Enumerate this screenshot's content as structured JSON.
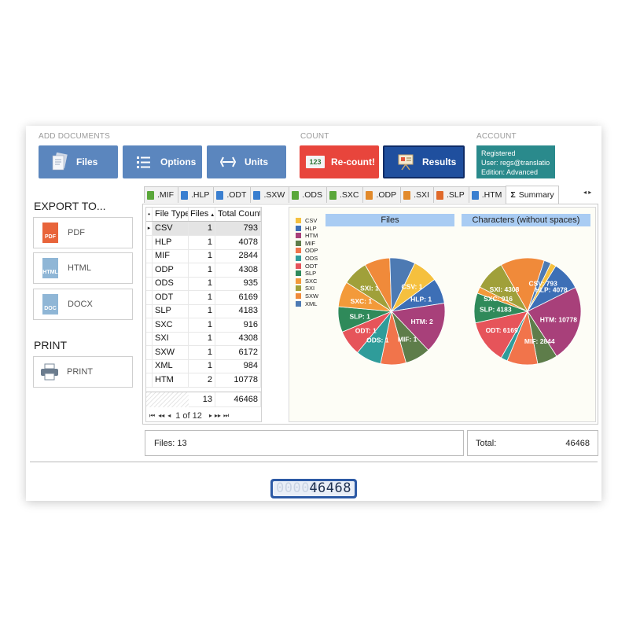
{
  "sections": {
    "add_documents": "ADD DOCUMENTS",
    "count": "COUNT",
    "account": "ACCOUNT"
  },
  "toolbar": {
    "files": "Files",
    "options": "Options",
    "units": "Units",
    "recount": "Re-count!",
    "recount_icon_text": "123",
    "results": "Results"
  },
  "account": {
    "status": "Registered",
    "user": "User: regs@translatio...",
    "edition": "Edition: Advanced"
  },
  "export": {
    "title": "EXPORT TO...",
    "pdf": "PDF",
    "html": "HTML",
    "docx": "DOCX",
    "pdf_icon_text": "PDF",
    "html_icon_text": "HTML",
    "docx_icon_text": "DOC"
  },
  "print": {
    "title": "PRINT",
    "button": "PRINT"
  },
  "tabs": [
    {
      "label": ".MIF",
      "color": "#5aa73a"
    },
    {
      "label": ".HLP",
      "color": "#3a7fd0"
    },
    {
      "label": ".ODT",
      "color": "#3a7fd0"
    },
    {
      "label": ".SXW",
      "color": "#3a7fd0"
    },
    {
      "label": ".ODS",
      "color": "#5aa73a"
    },
    {
      "label": ".SXC",
      "color": "#5aa73a"
    },
    {
      "label": ".ODP",
      "color": "#e28a2b"
    },
    {
      "label": ".SXI",
      "color": "#e28a2b"
    },
    {
      "label": ".SLP",
      "color": "#e06a2b"
    },
    {
      "label": ".HTM",
      "color": "#3a7fd0"
    },
    {
      "label": "Summary",
      "icon": "Σ"
    }
  ],
  "tab_arrows": "◂ ▸",
  "grid": {
    "headers": [
      "File Type",
      "Files",
      "Total Count"
    ],
    "rows": [
      [
        "CSV",
        "1",
        "793"
      ],
      [
        "HLP",
        "1",
        "4078"
      ],
      [
        "MIF",
        "1",
        "2844"
      ],
      [
        "ODP",
        "1",
        "4308"
      ],
      [
        "ODS",
        "1",
        "935"
      ],
      [
        "ODT",
        "1",
        "6169"
      ],
      [
        "SLP",
        "1",
        "4183"
      ],
      [
        "SXC",
        "1",
        "916"
      ],
      [
        "SXI",
        "1",
        "4308"
      ],
      [
        "SXW",
        "1",
        "6172"
      ],
      [
        "XML",
        "1",
        "984"
      ],
      [
        "HTM",
        "2",
        "10778"
      ]
    ],
    "total_files": "13",
    "total_count": "46468",
    "pager": "1 of 12",
    "sort_glyph": "▲"
  },
  "chart_data": [
    {
      "type": "pie",
      "title": "Files",
      "categories": [
        "CSV",
        "HLP",
        "HTM",
        "MIF",
        "ODP",
        "ODS",
        "ODT",
        "SLP",
        "SXC",
        "SXI",
        "SXW",
        "XML"
      ],
      "values": [
        1,
        1,
        2,
        1,
        1,
        1,
        1,
        1,
        1,
        1,
        1,
        1
      ],
      "labels": [
        "CSV: 1",
        "HLP: 1",
        "HTM: 2",
        "MIF: 1",
        "",
        "ODS: 1",
        "ODT: 1",
        "SLP: 1",
        "SXC: 1",
        "SXI: 1",
        "",
        ""
      ],
      "legend": "left"
    },
    {
      "type": "pie",
      "title": "Characters (without spaces)",
      "categories": [
        "CSV",
        "HLP",
        "HTM",
        "MIF",
        "ODP",
        "ODS",
        "ODT",
        "SLP",
        "SXC",
        "SXI",
        "SXW",
        "XML"
      ],
      "values": [
        793,
        4078,
        10778,
        2844,
        4308,
        935,
        6169,
        4183,
        916,
        4308,
        6172,
        984
      ],
      "labels": [
        "CSV: 793",
        "HLP: 4078",
        "HTM: 10778",
        "MIF: 2844",
        "",
        "",
        "ODT: 6169",
        "SLP: 4183",
        "SXC: 916",
        "SXI: 4308",
        "",
        ""
      ]
    }
  ],
  "legend": {
    "colors": [
      "#f5c03e",
      "#3d6fb6",
      "#a8407a",
      "#5e7d4a",
      "#f1744b",
      "#2f9c9a",
      "#e6545a",
      "#2f8a5a",
      "#f39a3a",
      "#a0a03a",
      "#f08a3a",
      "#4d7ab3"
    ]
  },
  "status": {
    "files": "Files: 13",
    "total_label": "Total:",
    "total_value": "46468"
  },
  "counter": {
    "ghost": "00000",
    "value": "46468"
  }
}
